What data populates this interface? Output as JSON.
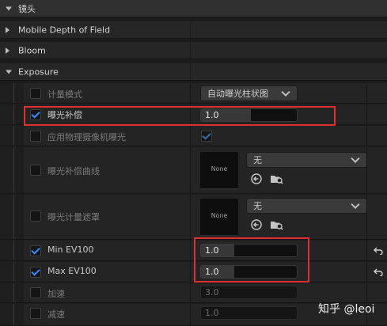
{
  "sections": {
    "lens": "镜头",
    "mobile_dof": "Mobile Depth of Field",
    "bloom": "Bloom",
    "exposure": "Exposure"
  },
  "rows": {
    "metering_mode": {
      "label": "计量模式",
      "value": "自动曝光柱状图"
    },
    "exposure_compensation": {
      "label": "曝光补偿",
      "value": "1.0",
      "checked": true
    },
    "apply_physical_camera": {
      "label": "应用物理摄像机曝光",
      "checked": true
    },
    "exposure_curve": {
      "label": "曝光补偿曲线",
      "asset": "None",
      "dropdown": "无"
    },
    "metering_mask": {
      "label": "曝光计量遮罩",
      "asset": "None",
      "dropdown": "无"
    },
    "min_ev100": {
      "label": "Min EV100",
      "value": "1.0",
      "checked": true
    },
    "max_ev100": {
      "label": "Max EV100",
      "value": "1.0",
      "checked": true
    },
    "speed_up": {
      "label": "加速",
      "value": "3.0",
      "checked": false
    },
    "speed_down": {
      "label": "减速",
      "value": "1.0",
      "checked": false
    }
  },
  "watermark": "知乎 @leoi",
  "colors": {
    "accent": "#2f8fff",
    "highlight_box": "#e0302e"
  }
}
